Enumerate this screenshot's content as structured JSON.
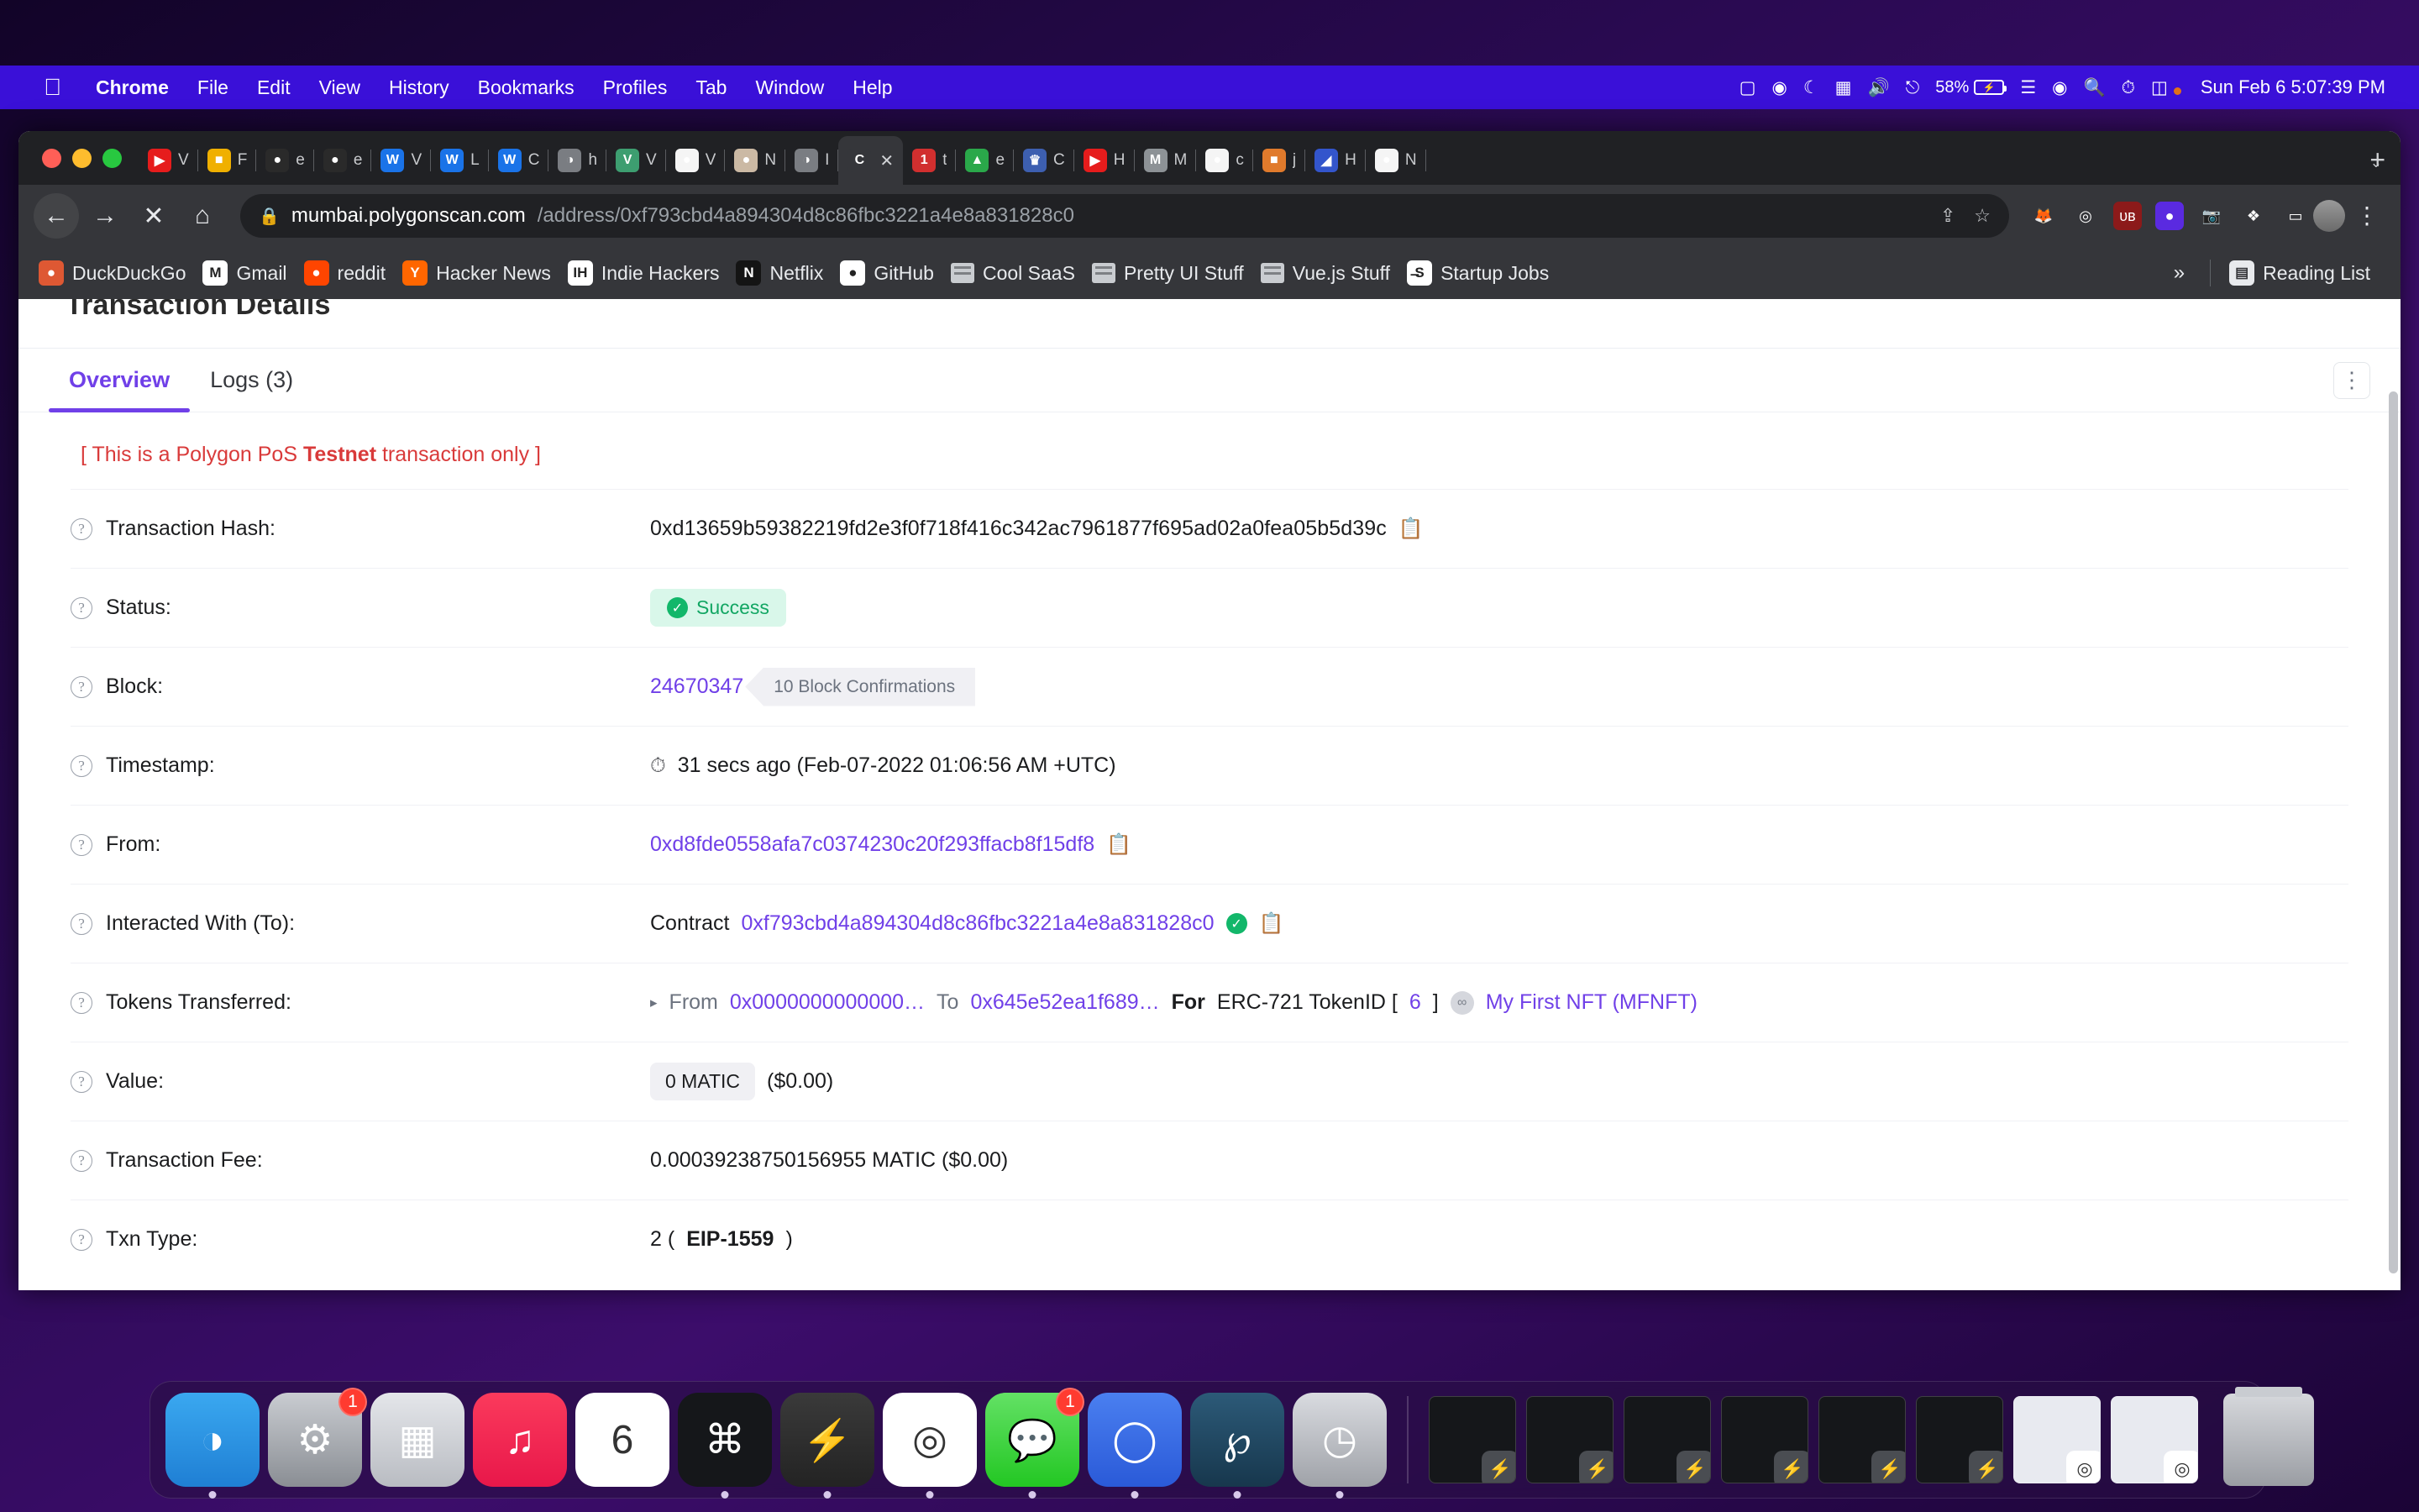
{
  "menubar": {
    "apple": "apple-logo",
    "items": [
      "Chrome",
      "File",
      "Edit",
      "View",
      "History",
      "Bookmarks",
      "Profiles",
      "Tab",
      "Window",
      "Help"
    ],
    "battery_percent": "58%",
    "clock": "Sun Feb 6  5:07:39 PM",
    "status_icons": [
      "screen-record-icon",
      "play-circle-icon",
      "moon-icon",
      "grid-panel-icon",
      "volume-icon",
      "bluetooth-icon",
      "battery-icon",
      "wifi-icon",
      "user-circle-icon",
      "search-icon",
      "time-machine-icon",
      "control-center-icon"
    ]
  },
  "browser": {
    "tabs": [
      {
        "letter": "▶",
        "bg": "#e61c1c",
        "title": "V",
        "active": false
      },
      {
        "letter": "■",
        "bg": "#f0b000",
        "title": "F",
        "active": false
      },
      {
        "letter": "●",
        "bg": "#2a2a2a",
        "title": "e",
        "active": false
      },
      {
        "letter": "●",
        "bg": "#2a2a2a",
        "title": "e",
        "active": false
      },
      {
        "letter": "W",
        "bg": "#1a73e8",
        "title": "V",
        "active": false
      },
      {
        "letter": "W",
        "bg": "#1a73e8",
        "title": "L",
        "active": false
      },
      {
        "letter": "W",
        "bg": "#1a73e8",
        "title": "C",
        "active": false
      },
      {
        "letter": "◑",
        "bg": "#7a7d82",
        "title": "h",
        "active": false
      },
      {
        "letter": "V",
        "bg": "#3d9e70",
        "title": "V",
        "active": false
      },
      {
        "letter": "●",
        "bg": "#f5f5f5",
        "title": "V",
        "active": false
      },
      {
        "letter": "●",
        "bg": "#cbb9a4",
        "title": "N",
        "active": false
      },
      {
        "letter": "◑",
        "bg": "#7a7d82",
        "title": "I",
        "active": false
      },
      {
        "letter": "C",
        "bg": "#35363a",
        "title": "",
        "active": true
      },
      {
        "letter": "1",
        "bg": "#d12f2f",
        "title": "t",
        "active": false
      },
      {
        "letter": "▲",
        "bg": "#2aa84a",
        "title": "e",
        "active": false
      },
      {
        "letter": "♛",
        "bg": "#3d5fb0",
        "title": "C",
        "active": false
      },
      {
        "letter": "▶",
        "bg": "#e61c1c",
        "title": "H",
        "active": false
      },
      {
        "letter": "M",
        "bg": "#8d9296",
        "title": "M",
        "active": false
      },
      {
        "letter": "●",
        "bg": "#f5f5f5",
        "title": "c",
        "active": false
      },
      {
        "letter": "■",
        "bg": "#e07a2c",
        "title": "j",
        "active": false
      },
      {
        "letter": "◢",
        "bg": "#3355cc",
        "title": "H",
        "active": false
      },
      {
        "letter": "●",
        "bg": "#f5f5f5",
        "title": "N",
        "active": false
      }
    ],
    "new_tab_label": "+",
    "tab_list_chevron": "⌄",
    "nav": {
      "back": "←",
      "forward": "→",
      "stop": "✕",
      "home": "⌂"
    },
    "url": {
      "lock_icon": "lock-icon",
      "host": "mumbai.polygonscan.com",
      "path": "/address/0xf793cbd4a894304d8c86fbc3221a4e8a831828c0"
    },
    "omni_actions": [
      "share-icon",
      "bookmark-star-icon"
    ],
    "extensions": [
      {
        "name": "metamask-icon",
        "glyph": "🦊",
        "bg": "transparent"
      },
      {
        "name": "rainbow-wallet-icon",
        "glyph": "◎",
        "bg": "transparent"
      },
      {
        "name": "ublock-origin-icon",
        "glyph": "ᴜʙ",
        "bg": "#8c1a1a"
      },
      {
        "name": "ghost-privacy-icon",
        "glyph": "●",
        "bg": "#5a2ae0"
      },
      {
        "name": "screenshot-camera-icon",
        "glyph": "📷",
        "bg": "transparent"
      },
      {
        "name": "extensions-puzzle-icon",
        "glyph": "❖",
        "bg": "transparent"
      },
      {
        "name": "cast-icon",
        "glyph": "▭",
        "bg": "transparent"
      }
    ],
    "avatar": "profile-avatar",
    "menu_kebab": "⋮",
    "bookmarks": [
      {
        "label": "DuckDuckGo",
        "icon_glyph": "●",
        "icon_bg": "#de5833",
        "type": "site"
      },
      {
        "label": "Gmail",
        "icon_glyph": "M",
        "icon_bg": "#ffffff",
        "type": "site"
      },
      {
        "label": "reddit",
        "icon_glyph": "●",
        "icon_bg": "#ff4500",
        "type": "site"
      },
      {
        "label": "Hacker News",
        "icon_glyph": "Y",
        "icon_bg": "#ff6600",
        "type": "site"
      },
      {
        "label": "Indie Hackers",
        "icon_glyph": "IH",
        "icon_bg": "#ffffff",
        "type": "site"
      },
      {
        "label": "Netflix",
        "icon_glyph": "N",
        "icon_bg": "#141414",
        "type": "site"
      },
      {
        "label": "GitHub",
        "icon_glyph": "●",
        "icon_bg": "#ffffff",
        "type": "site"
      },
      {
        "label": "Cool SaaS",
        "icon_glyph": "",
        "icon_bg": "",
        "type": "folder"
      },
      {
        "label": "Pretty UI Stuff",
        "icon_glyph": "",
        "icon_bg": "",
        "type": "folder"
      },
      {
        "label": "Vue.js Stuff",
        "icon_glyph": "",
        "icon_bg": "",
        "type": "folder"
      },
      {
        "label": "Startup Jobs",
        "icon_glyph": "̶S",
        "icon_bg": "#ffffff",
        "type": "site"
      }
    ],
    "bookmarks_overflow": "»",
    "reading_list_label": "Reading List"
  },
  "page": {
    "title": "Transaction Details",
    "tabs": [
      {
        "label": "Overview",
        "active": true
      },
      {
        "label": "Logs (3)",
        "active": false
      }
    ],
    "kebab": "⋮",
    "testnet_note_pre": "[ This is a Polygon PoS ",
    "testnet_note_bold": "Testnet",
    "testnet_note_post": " transaction only ]",
    "rows": {
      "tx_hash": {
        "label": "Transaction Hash:",
        "value": "0xd13659b59382219fd2e3f0f718f416c342ac7961877f695ad02a0fea05b5d39c",
        "copy_icon": "copy-icon"
      },
      "status": {
        "label": "Status:",
        "value": "Success"
      },
      "block": {
        "label": "Block:",
        "number": "24670347",
        "confirmations": "10 Block Confirmations"
      },
      "timestamp": {
        "label": "Timestamp:",
        "value": "31 secs ago (Feb-07-2022 01:06:56 AM +UTC)"
      },
      "from": {
        "label": "From:",
        "address": "0xd8fde0558afa7c0374230c20f293ffacb8f15df8",
        "copy_icon": "copy-icon"
      },
      "to": {
        "label": "Interacted With (To):",
        "prefix": "Contract",
        "address": "0xf793cbd4a894304d8c86fbc3221a4e8a831828c0",
        "verified_icon": "verified-check-icon",
        "copy_icon": "copy-icon"
      },
      "tokens": {
        "label": "Tokens Transferred:",
        "expand": "▸",
        "from_word": "From",
        "from_addr": "0x0000000000000…",
        "to_word": "To",
        "to_addr": "0x645e52ea1f689…",
        "for_word": "For",
        "standard": "ERC-721 TokenID [",
        "token_id": "6",
        "standard_close": "]",
        "token_name": "My First NFT (MFNFT)"
      },
      "value": {
        "label": "Value:",
        "amount": "0 MATIC",
        "usd": "($0.00)"
      },
      "fee": {
        "label": "Transaction Fee:",
        "value": "0.00039238750156955 MATIC ($0.00)"
      },
      "txn_type": {
        "label": "Txn Type:",
        "value_pre": "2 (",
        "value_bold": "EIP-1559",
        "value_post": ")"
      }
    }
  },
  "dock": {
    "apps": [
      {
        "name": "finder",
        "glyph": "◑",
        "bg": "linear-gradient(180deg,#3aa8f0,#1f7fd4)",
        "badge": "",
        "running": true
      },
      {
        "name": "system-preferences",
        "glyph": "⚙",
        "bg": "linear-gradient(180deg,#c9ccd1,#8a8e94)",
        "badge": "1",
        "running": false
      },
      {
        "name": "launchpad",
        "glyph": "▦",
        "bg": "linear-gradient(180deg,#e4e6ea,#b9bcc2)",
        "badge": "",
        "running": false
      },
      {
        "name": "music",
        "glyph": "♫",
        "bg": "linear-gradient(180deg,#fb3a5c,#e8174a)",
        "badge": "",
        "running": false
      },
      {
        "name": "calendar",
        "glyph": "6",
        "bg": "#ffffff",
        "badge": "",
        "running": false
      },
      {
        "name": "terminal",
        "glyph": "⌘",
        "bg": "#15171a",
        "badge": "",
        "running": true
      },
      {
        "name": "sublime-text",
        "glyph": "⚡",
        "bg": "linear-gradient(180deg,#3a3a3a,#232323)",
        "badge": "",
        "running": true
      },
      {
        "name": "google-chrome",
        "glyph": "◎",
        "bg": "#ffffff",
        "badge": "",
        "running": true
      },
      {
        "name": "messages",
        "glyph": "💬",
        "bg": "linear-gradient(180deg,#63e165,#23c723)",
        "badge": "1",
        "running": true
      },
      {
        "name": "signal",
        "glyph": "◯",
        "bg": "linear-gradient(180deg,#4a7ff0,#2a5ad8)",
        "badge": "",
        "running": true
      },
      {
        "name": "postman",
        "glyph": "℘",
        "bg": "linear-gradient(180deg,#2c5a78,#17374d)",
        "badge": "",
        "running": true
      },
      {
        "name": "final-cut-pro",
        "glyph": "◷",
        "bg": "linear-gradient(180deg,#d9dbe0,#9fa2a8)",
        "badge": "",
        "running": true
      }
    ],
    "minimized": [
      {
        "name": "sublime-window",
        "badge_glyph": "⚡",
        "badge_bg": "#4a4d52"
      },
      {
        "name": "sublime-window",
        "badge_glyph": "⚡",
        "badge_bg": "#4a4d52"
      },
      {
        "name": "sublime-window",
        "badge_glyph": "⚡",
        "badge_bg": "#4a4d52"
      },
      {
        "name": "sublime-window",
        "badge_glyph": "⚡",
        "badge_bg": "#4a4d52"
      },
      {
        "name": "sublime-window",
        "badge_glyph": "⚡",
        "badge_bg": "#4a4d52"
      },
      {
        "name": "sublime-window",
        "badge_glyph": "⚡",
        "badge_bg": "#4a4d52"
      },
      {
        "name": "chrome-window",
        "badge_glyph": "◎",
        "badge_bg": "#ffffff"
      },
      {
        "name": "chrome-window",
        "badge_glyph": "◎",
        "badge_bg": "#ffffff"
      }
    ],
    "trash": "trash-icon"
  },
  "colors": {
    "accent_purple": "#7040e8",
    "menubar_blue": "#3a10d8",
    "success_green": "#12a663",
    "testnet_red": "#d93a3a"
  }
}
